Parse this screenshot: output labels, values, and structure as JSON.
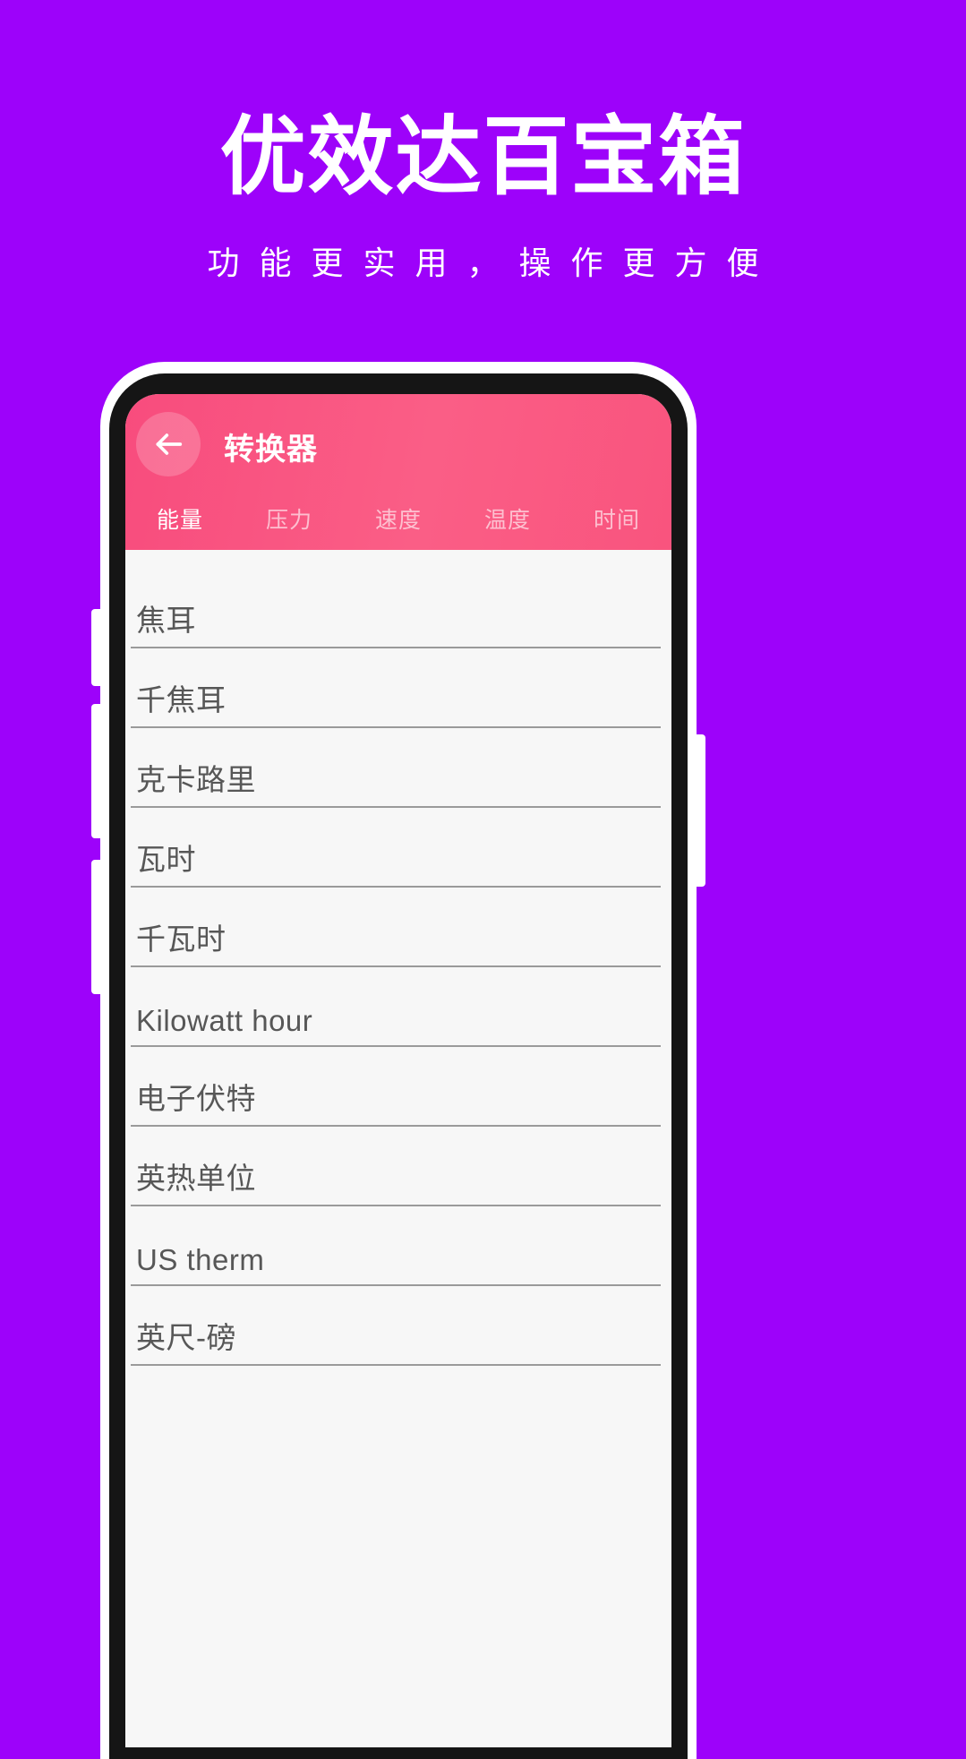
{
  "promo": {
    "title": "优效达百宝箱",
    "subtitle": "功能更实用，操作更方便",
    "background_color": "#9D02FA",
    "text_color": "#FFFFFF"
  },
  "app": {
    "accent_color": "#F84C7D",
    "header": {
      "title": "转换器",
      "back_icon": "arrow-left-icon"
    },
    "tabs": [
      {
        "label": "能量",
        "active": true
      },
      {
        "label": "压力",
        "active": false
      },
      {
        "label": "速度",
        "active": false
      },
      {
        "label": "温度",
        "active": false
      },
      {
        "label": "时间",
        "active": false
      }
    ],
    "unit_list": [
      {
        "label": "焦耳",
        "value": ""
      },
      {
        "label": "千焦耳",
        "value": ""
      },
      {
        "label": "克卡路里",
        "value": ""
      },
      {
        "label": "瓦时",
        "value": ""
      },
      {
        "label": "千瓦时",
        "value": ""
      },
      {
        "label": "Kilowatt hour",
        "value": ""
      },
      {
        "label": "电子伏特",
        "value": ""
      },
      {
        "label": "英热单位",
        "value": ""
      },
      {
        "label": "US therm",
        "value": ""
      },
      {
        "label": "英尺-磅",
        "value": ""
      }
    ]
  }
}
